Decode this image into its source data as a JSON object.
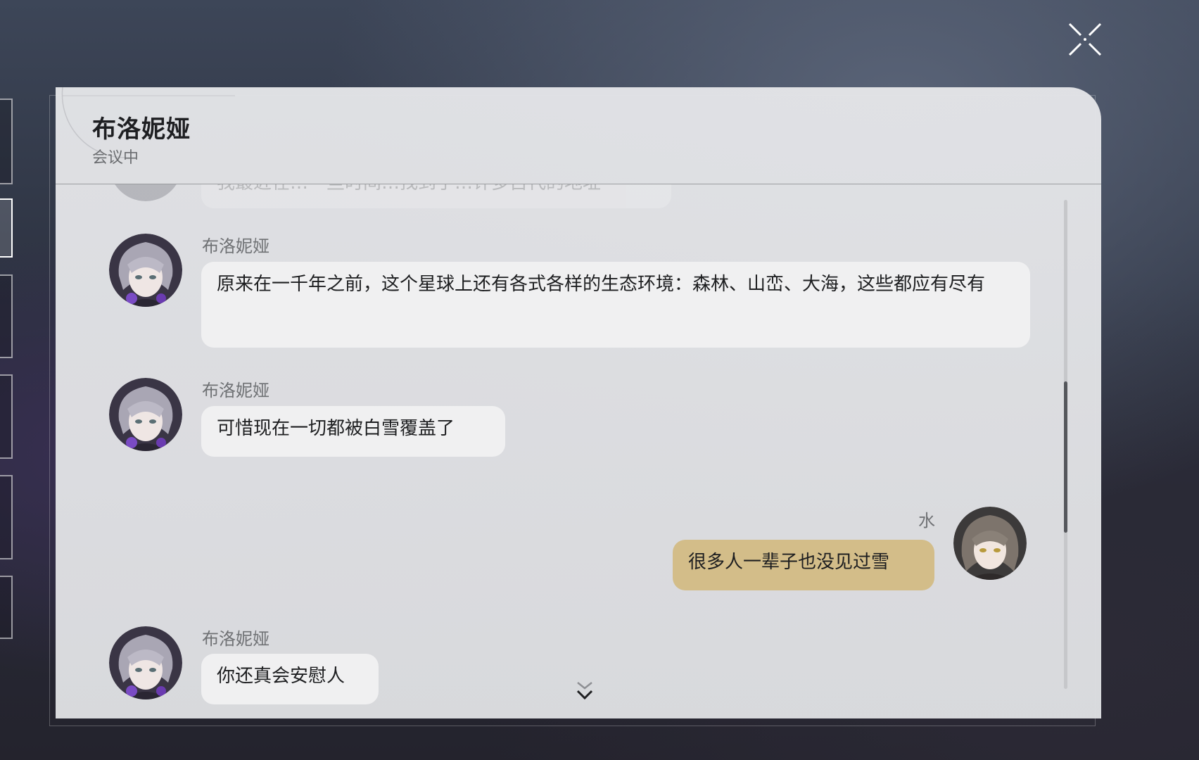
{
  "header": {
    "title": "布洛妮娅",
    "status": "会议中"
  },
  "messages": [
    {
      "sender": "",
      "text": "我最近在…一些时间…找到了…许多古代的地址",
      "side": "left",
      "partial": true
    },
    {
      "sender": "布洛妮娅",
      "text": "原来在一千年之前，这个星球上还有各式各样的生态环境：森林、山峦、大海，这些都应有尽有",
      "side": "left"
    },
    {
      "sender": "布洛妮娅",
      "text": "可惜现在一切都被白雪覆盖了",
      "side": "left"
    },
    {
      "sender": "水",
      "text": "很多人一辈子也没见过雪",
      "side": "right"
    },
    {
      "sender": "布洛妮娅",
      "text": "你还真会安慰人",
      "side": "left"
    }
  ],
  "icons": {
    "close": "close-icon",
    "scroll_down": "double-chevron-down-icon"
  },
  "colors": {
    "panel_bg": "#e3e4e7",
    "bubble_left": "#f0f0f1",
    "bubble_right": "#d3bd89",
    "title_text": "#1e1f22"
  }
}
